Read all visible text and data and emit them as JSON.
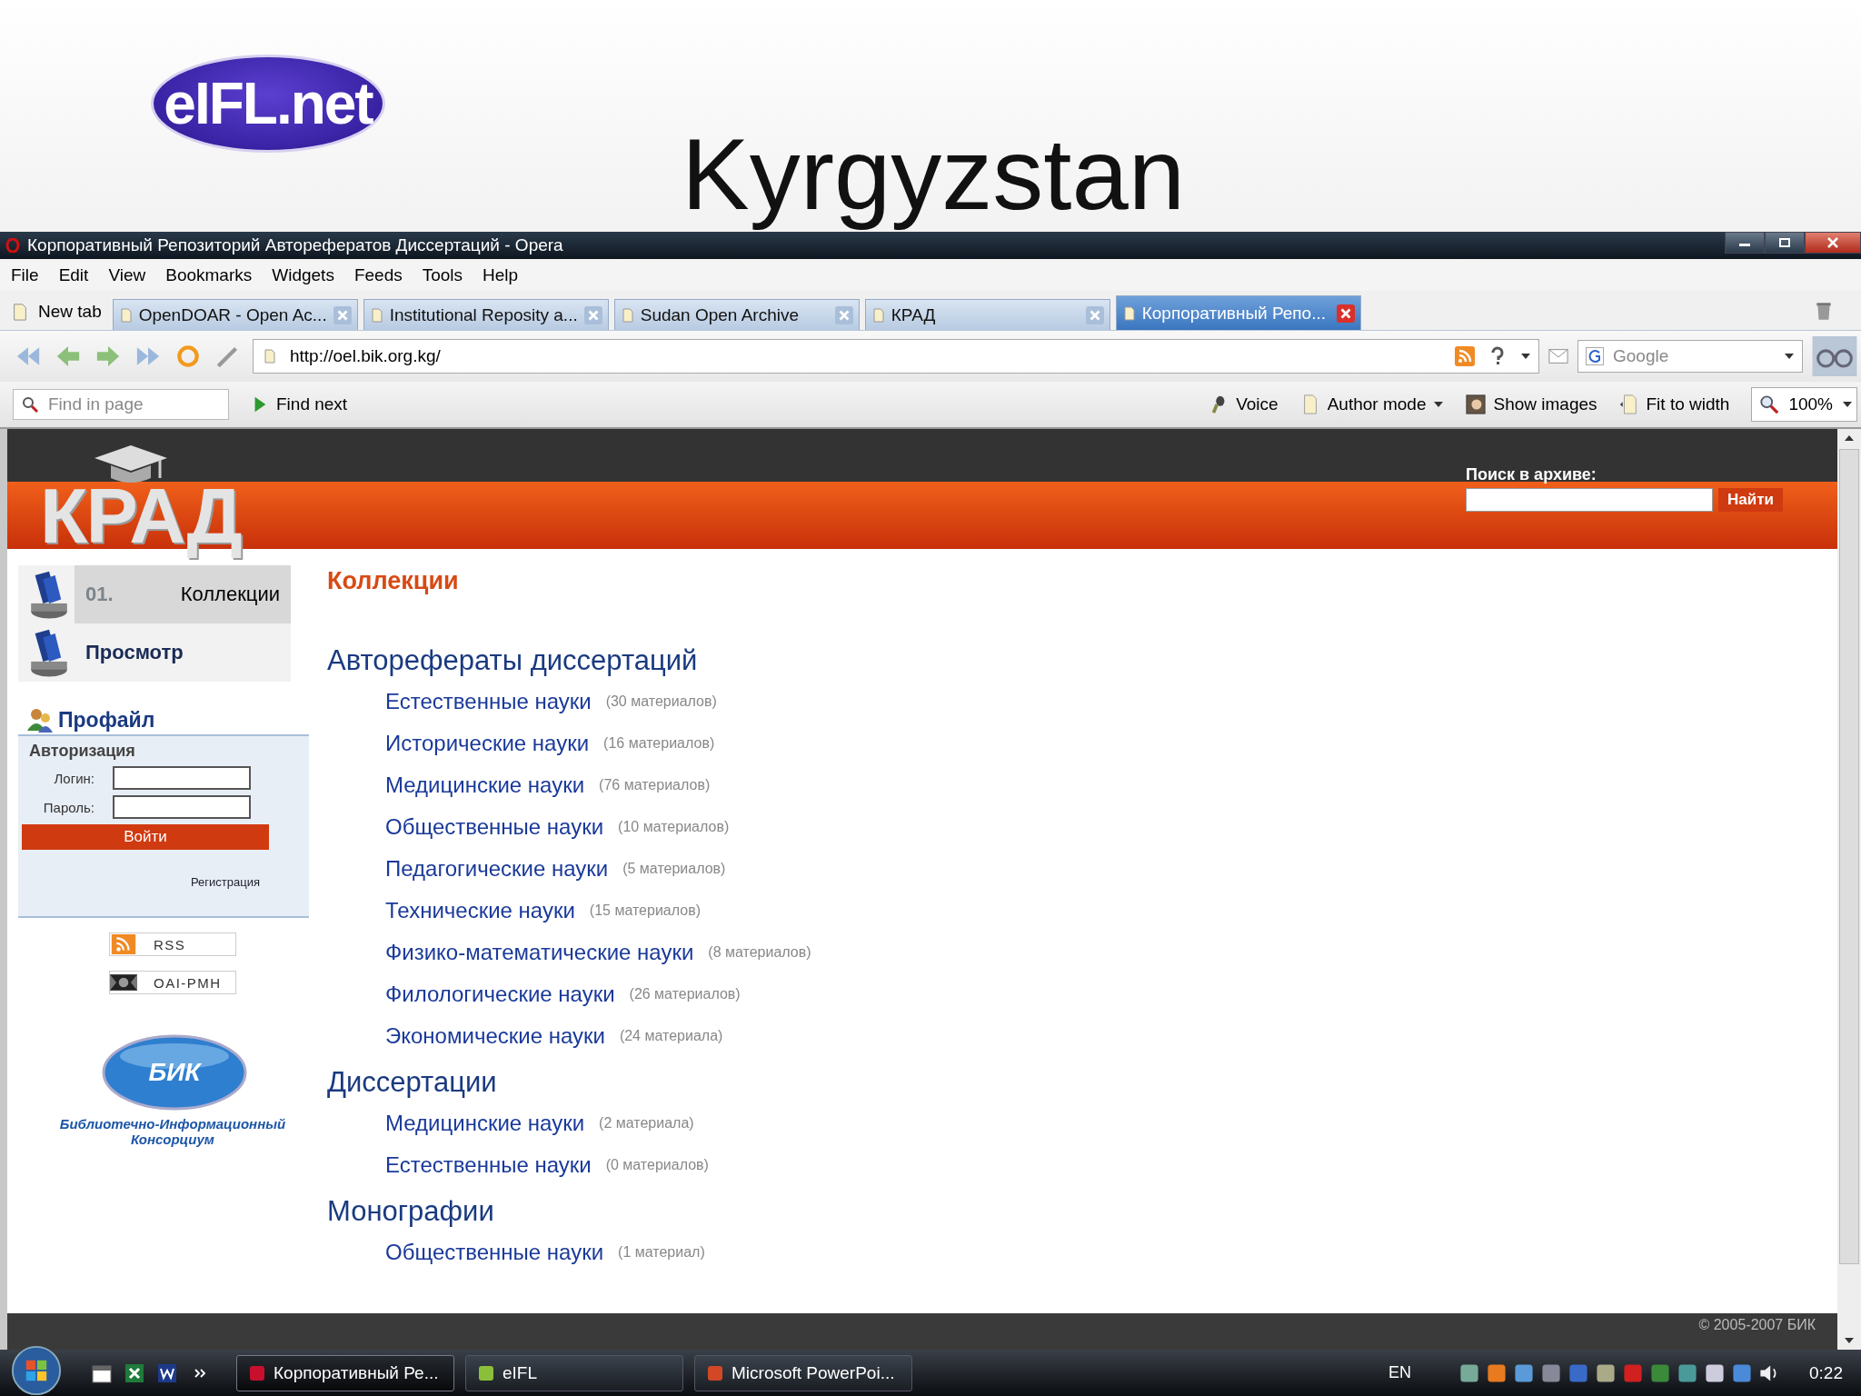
{
  "slide": {
    "logo": "eIFL.net",
    "title": "Kyrgyzstan"
  },
  "window": {
    "title": "Корпоративный Репозиторий Авторефератов Диссертаций - Opera"
  },
  "menu": [
    "File",
    "Edit",
    "View",
    "Bookmarks",
    "Widgets",
    "Feeds",
    "Tools",
    "Help"
  ],
  "new_tab": "New tab",
  "tabs": [
    {
      "label": "OpenDOAR - Open Ac...",
      "selected": false
    },
    {
      "label": "Institutional Reposity a...",
      "selected": false
    },
    {
      "label": "Sudan Open Archive",
      "selected": false
    },
    {
      "label": "КРАД",
      "selected": false
    },
    {
      "label": "Корпоративный Репо...",
      "selected": true
    }
  ],
  "address": {
    "value": "http://oel.bik.org.kg/"
  },
  "search_engine": {
    "placeholder": "Google"
  },
  "find": {
    "placeholder": "Find in page",
    "next": "Find next"
  },
  "tools": [
    "Voice",
    "Author mode",
    "Show images",
    "Fit to width"
  ],
  "zoom": "100%",
  "site": {
    "logo": "КРАД",
    "search_label": "Поиск в архиве:",
    "search_button": "Найти",
    "nav": [
      {
        "number": "01.",
        "label": "Коллекции",
        "selected": true
      },
      {
        "label": "Просмотр",
        "selected": false
      }
    ],
    "profile": "Профайл",
    "auth": "Авторизация",
    "login_label": "Логин:",
    "password_label": "Пароль:",
    "login_button": "Войти",
    "register": "Регистрация",
    "feeds": [
      "RSS",
      "OAI-PMH"
    ],
    "partner_logo": "БИК",
    "partner_name": "Библиотечно-Информационный Консорциум",
    "heading": "Коллекции",
    "sections": [
      {
        "title": "Авторефераты диссертаций",
        "items": [
          {
            "name": "Естественные науки",
            "count": "(30 материалов)"
          },
          {
            "name": "Исторические науки",
            "count": "(16 материалов)"
          },
          {
            "name": "Медицинские науки",
            "count": "(76 материалов)"
          },
          {
            "name": "Общественные науки",
            "count": "(10 материалов)"
          },
          {
            "name": "Педагогические науки",
            "count": "(5 материалов)"
          },
          {
            "name": "Технические науки",
            "count": "(15 материалов)"
          },
          {
            "name": "Физико-математические науки",
            "count": "(8 материалов)"
          },
          {
            "name": "Филологические науки",
            "count": "(26 материалов)"
          },
          {
            "name": "Экономические науки",
            "count": "(24 материала)"
          }
        ]
      },
      {
        "title": "Диссертации",
        "items": [
          {
            "name": "Медицинские науки",
            "count": "(2 материала)"
          },
          {
            "name": "Естественные науки",
            "count": "(0 материалов)"
          }
        ]
      },
      {
        "title": "Монографии",
        "items": [
          {
            "name": "Общественные науки",
            "count": "(1 материал)"
          }
        ]
      }
    ],
    "copyright": "© 2005-2007 БИК"
  },
  "taskbar": {
    "items": [
      {
        "label": "Корпоративный Ре...",
        "kind": "opera",
        "selected": true
      },
      {
        "label": "eIFL",
        "kind": "folder",
        "selected": false
      },
      {
        "label": "Microsoft PowerPoi...",
        "kind": "powerpoint",
        "selected": false
      }
    ],
    "language": "EN",
    "clock": "0:22"
  }
}
